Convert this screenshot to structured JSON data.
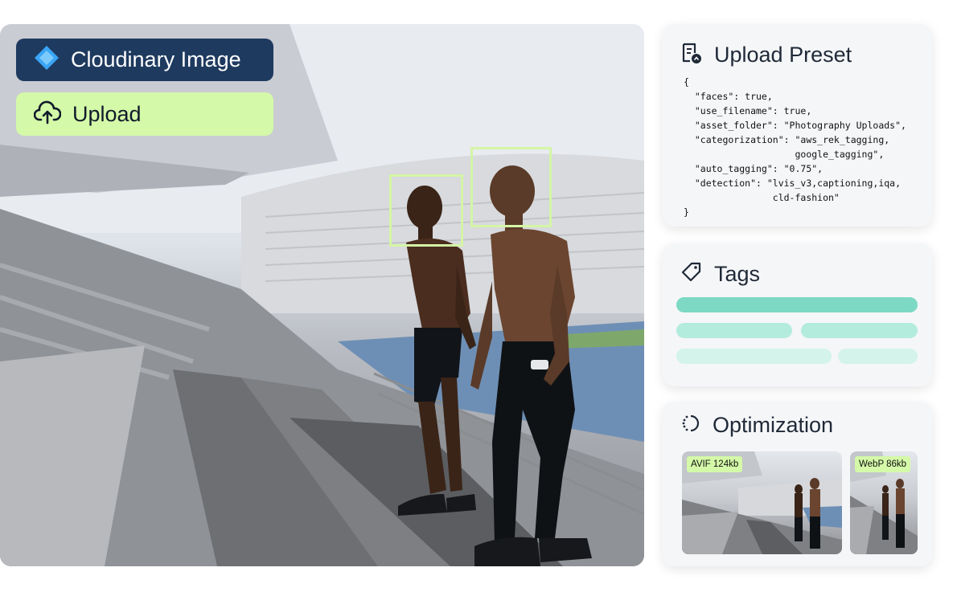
{
  "overlay": {
    "title_label": "Cloudinary Image",
    "upload_label": "Upload"
  },
  "icons": {
    "title": "cloudinary-diamond-icon",
    "upload": "cloud-upload-icon",
    "preset": "document-settings-icon",
    "tags": "tag-icon",
    "optimization": "optimization-dots-icon"
  },
  "preset": {
    "title": "Upload Preset",
    "json_text": "{\n  \"faces\": true,\n  \"use_filename\": true,\n  \"asset_folder\": \"Photography Uploads\",\n  \"categorization\": \"aws_rek_tagging,\n                    google_tagging\",\n  \"auto_tagging\": \"0.75\",\n  \"detection\": \"lvis_v3,captioning,iqa,\n                cld-fashion\"\n}"
  },
  "tags": {
    "title": "Tags"
  },
  "optimization": {
    "title": "Optimization",
    "thumbnails": [
      {
        "label": "AVIF 124kb"
      },
      {
        "label": "WebP 86kb"
      }
    ]
  },
  "colors": {
    "accent_dark": "#1e3a5f",
    "accent_lime": "#d4f9a8",
    "tag_strong": "#7dd9c3",
    "tag_light": "#b3ecdd",
    "tag_faint": "#d3f3eb"
  }
}
